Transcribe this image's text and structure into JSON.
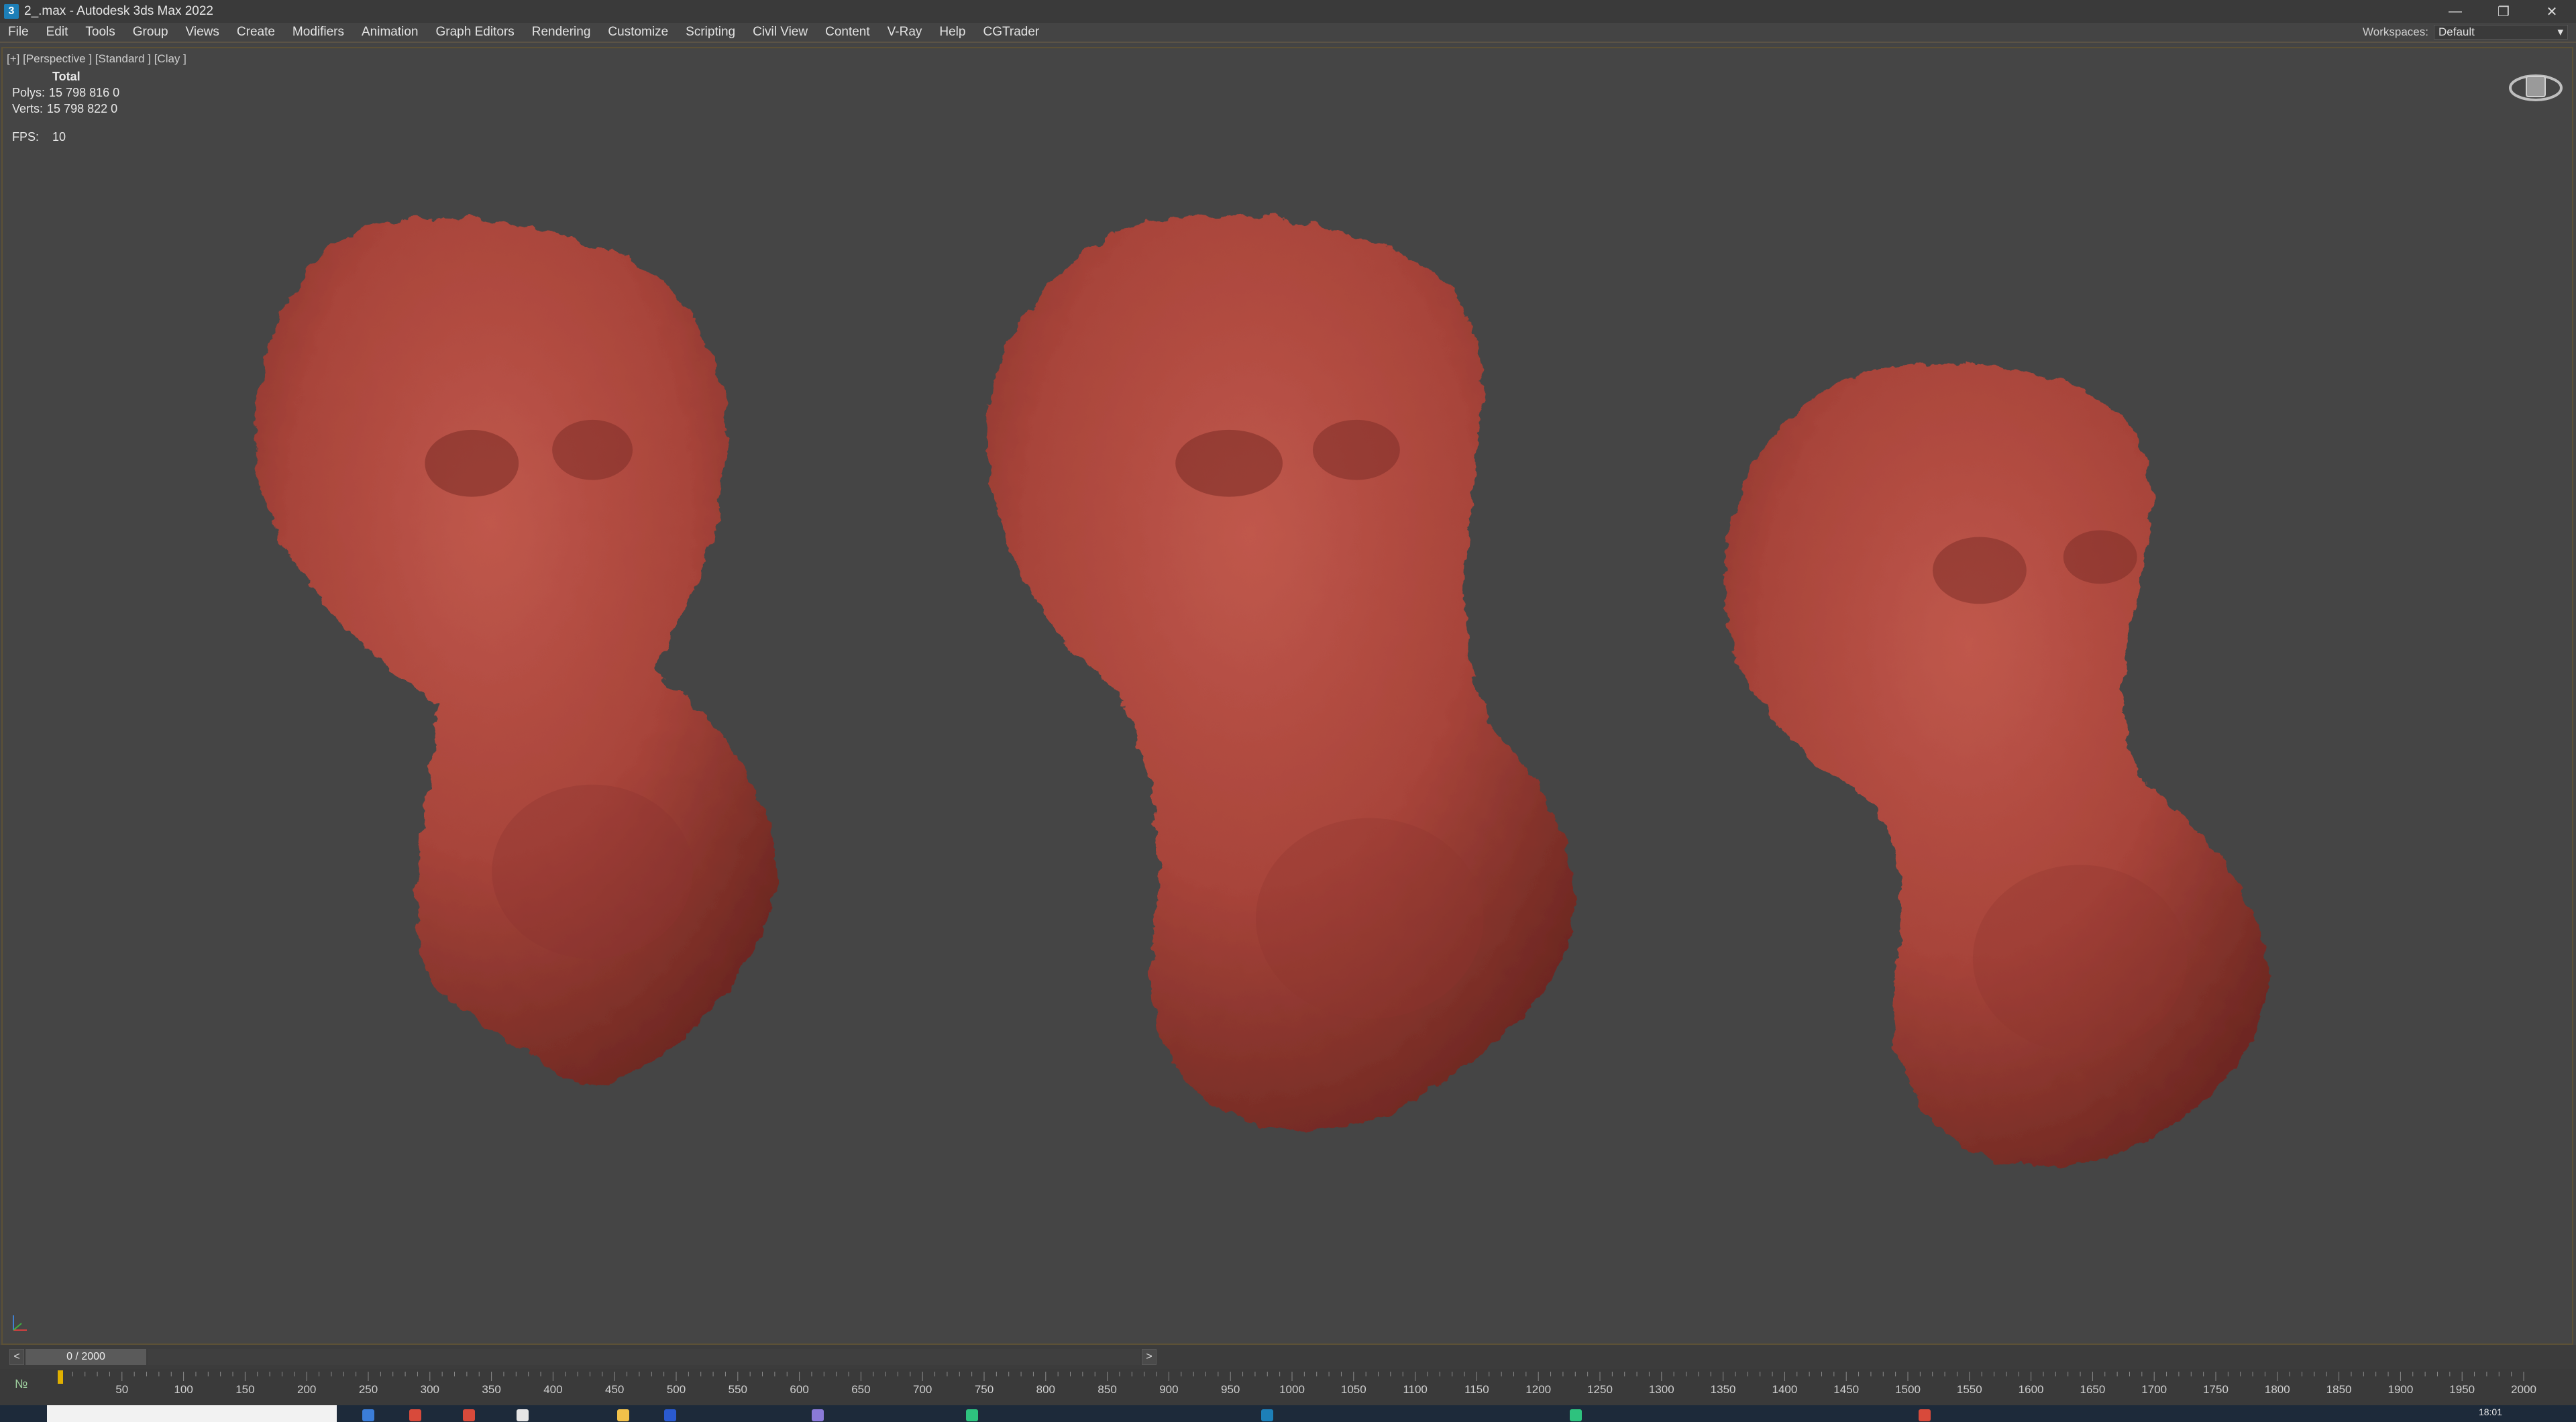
{
  "window": {
    "title": "2_.max - Autodesk 3ds Max 2022",
    "app_icon_glyph": "3",
    "controls": [
      "minimize-icon",
      "restore-icon",
      "close-icon"
    ]
  },
  "menu": {
    "items": [
      "File",
      "Edit",
      "Tools",
      "Group",
      "Views",
      "Create",
      "Modifiers",
      "Animation",
      "Graph Editors",
      "Rendering",
      "Customize",
      "Scripting",
      "Civil View",
      "Content",
      "V-Ray",
      "Help",
      "CGTrader"
    ],
    "workspaces_label": "Workspaces:",
    "workspace_value": "Default"
  },
  "viewport": {
    "label": "[+] [Perspective ] [Standard ] [Clay ]",
    "stats": {
      "header": "Total",
      "polys_label": "Polys:",
      "polys_value": "15 798 816 0",
      "verts_label": "Verts:",
      "verts_value": "15 798 822 0"
    },
    "fps_label": "FPS:",
    "fps_value": "10",
    "object_color": "#b4453c",
    "background": "#454545"
  },
  "timeslider": {
    "prev": "<",
    "next": ">",
    "frame_display": "0 / 2000"
  },
  "trackbar": {
    "ticks": [
      "50",
      "100",
      "150",
      "200",
      "250",
      "300",
      "350",
      "400",
      "450",
      "500",
      "550",
      "600",
      "650",
      "700",
      "750",
      "800",
      "850",
      "900",
      "950",
      "1000",
      "1050",
      "1100",
      "1150",
      "1200",
      "1250",
      "1300",
      "1350",
      "1400",
      "1450",
      "1500",
      "1550",
      "1600",
      "1650",
      "1700",
      "1750",
      "1800",
      "1850",
      "1900",
      "1950",
      "2000"
    ]
  },
  "taskbar": {
    "clock": "18:01"
  }
}
